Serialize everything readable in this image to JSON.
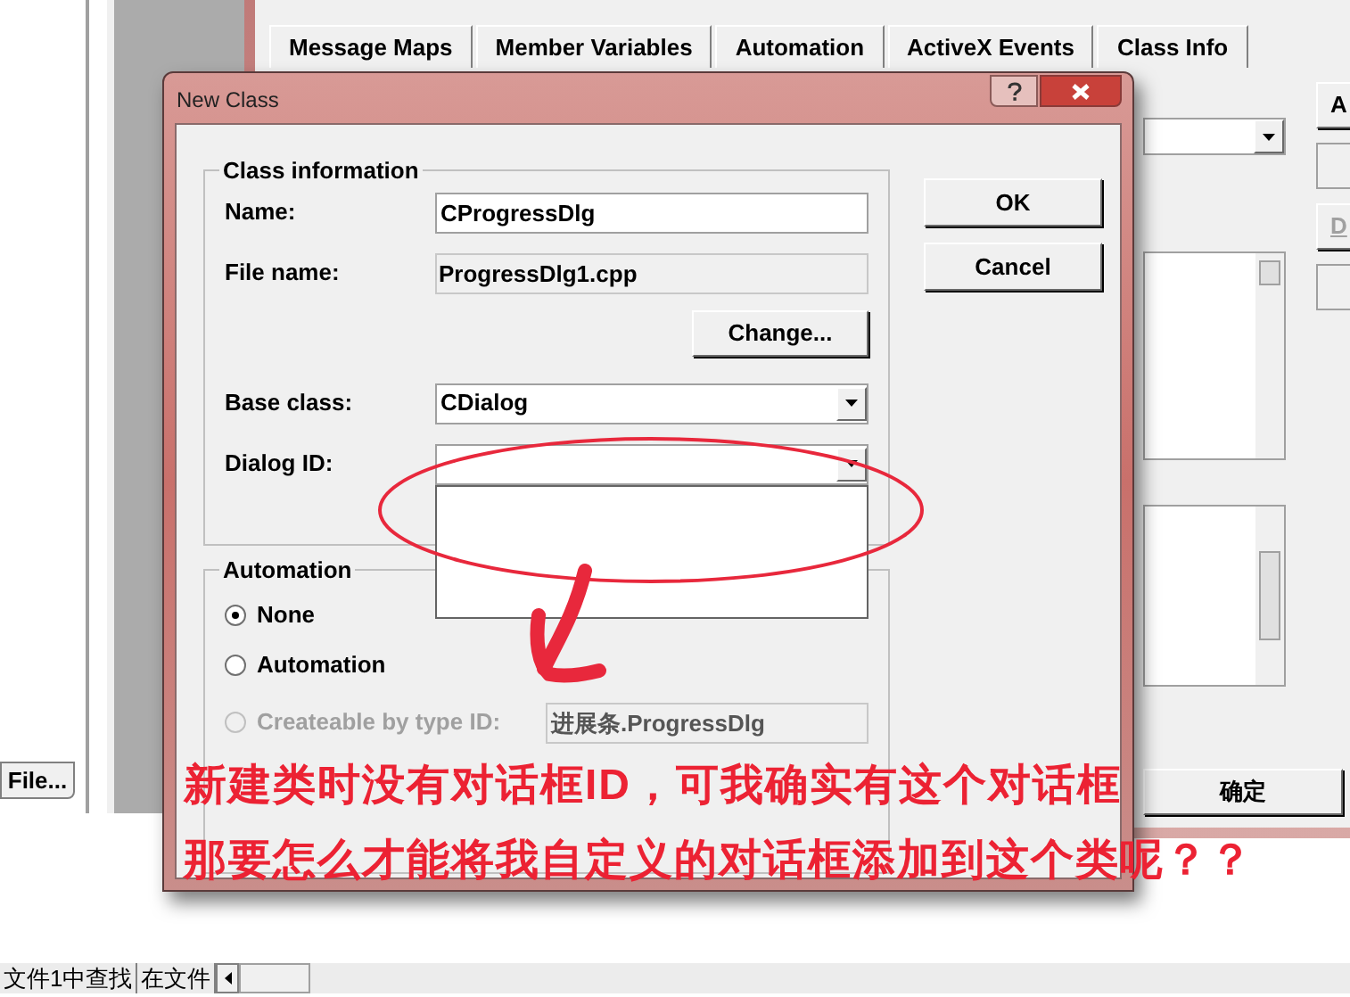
{
  "left_panel": {
    "button": "File..."
  },
  "background_window": {
    "tabs": [
      "Message Maps",
      "Member Variables",
      "Automation",
      "ActiveX Events",
      "Class Info"
    ],
    "side_buttons": [
      {
        "label": "A",
        "disabled": false
      },
      {
        "label": "D",
        "disabled": true
      }
    ],
    "ok_button": "确定"
  },
  "dialog": {
    "title": "New Class",
    "class_information": {
      "title": "Class information",
      "name": {
        "label": "Name:",
        "value": "CProgressDlg"
      },
      "file_name": {
        "label": "File name:",
        "value": "ProgressDlg1.cpp"
      },
      "change_button": "Change...",
      "base_class": {
        "label": "Base class:",
        "value": "CDialog"
      },
      "dialog_id": {
        "label": "Dialog ID:",
        "expanded": true
      }
    },
    "automation": {
      "title": "Automation",
      "options": [
        {
          "label": "None",
          "selected": true,
          "disabled": false
        },
        {
          "label": "Automation",
          "selected": false,
          "disabled": false
        },
        {
          "label": "Createable by type ID:",
          "selected": false,
          "disabled": true
        }
      ],
      "type_id": {
        "value": "进展条.ProgressDlg",
        "disabled": true
      }
    },
    "buttons": [
      "OK",
      "Cancel"
    ]
  },
  "annotation": {
    "lines": [
      "新建类时没有对话框ID，可我确实有这个对话框",
      "那要怎么才能将我自定义的对话框添加到这个类呢？？"
    ]
  },
  "bottom_tabs": [
    "文件1中查找",
    "在文件"
  ]
}
